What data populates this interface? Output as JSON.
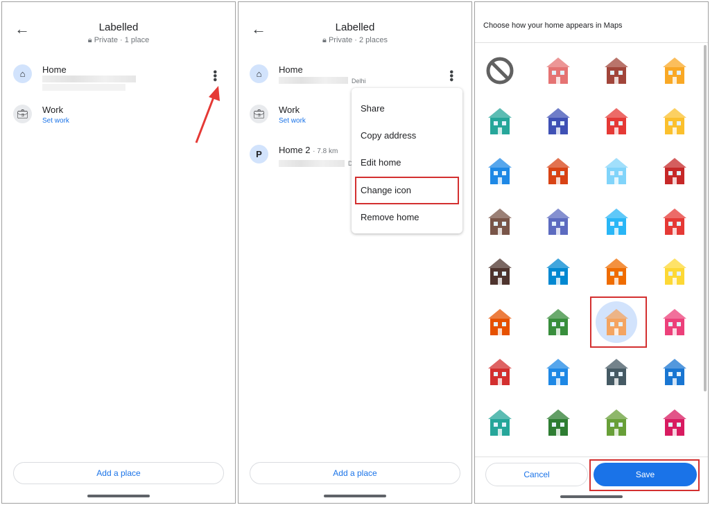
{
  "panel1": {
    "title": "Labelled",
    "subtitle": "Private · 1 place",
    "items": [
      {
        "name": "Home",
        "icon": "home-icon"
      },
      {
        "name": "Work",
        "link": "Set work",
        "icon": "briefcase-icon"
      }
    ],
    "add": "Add a place"
  },
  "panel2": {
    "title": "Labelled",
    "subtitle": "Private · 2 places",
    "items": [
      {
        "name": "Home",
        "meta": "Delhi"
      },
      {
        "name": "Work",
        "link": "Set work"
      },
      {
        "name": "Home 2",
        "distance": "· 7.8 km",
        "meta": "D"
      }
    ],
    "menu": [
      "Share",
      "Copy address",
      "Edit home",
      "Change icon",
      "Remove home"
    ],
    "add": "Add a place"
  },
  "panel3": {
    "heading": "Choose how your home appears in Maps",
    "cancel": "Cancel",
    "save": "Save",
    "selected_index": 22,
    "icons": [
      {
        "name": "none",
        "color": "#616161"
      },
      {
        "name": "brick-apartment",
        "color": "#e57373"
      },
      {
        "name": "barn",
        "color": "#a1453a"
      },
      {
        "name": "shop-building",
        "color": "#f9a825"
      },
      {
        "name": "camper-van",
        "color": "#26a69a"
      },
      {
        "name": "castle",
        "color": "#3f51b5"
      },
      {
        "name": "house-red-roof",
        "color": "#e53935"
      },
      {
        "name": "construction-crane",
        "color": "#fbc02d"
      },
      {
        "name": "skyscraper",
        "color": "#1e88e5"
      },
      {
        "name": "brick-house",
        "color": "#d84315"
      },
      {
        "name": "igloo",
        "color": "#81d4fa"
      },
      {
        "name": "lighthouse",
        "color": "#c62828"
      },
      {
        "name": "log-cabin",
        "color": "#795548"
      },
      {
        "name": "modern-building",
        "color": "#5c6bc0"
      },
      {
        "name": "store-front",
        "color": "#29b6f6"
      },
      {
        "name": "pagoda",
        "color": "#e53935"
      },
      {
        "name": "pirate-ship",
        "color": "#4e342e"
      },
      {
        "name": "sailboat",
        "color": "#0288d1"
      },
      {
        "name": "schoolhouse",
        "color": "#ef6c00"
      },
      {
        "name": "submarine",
        "color": "#fdd835"
      },
      {
        "name": "teepee",
        "color": "#e65100"
      },
      {
        "name": "treehouse",
        "color": "#388e3c"
      },
      {
        "name": "adobe-house",
        "color": "#f4a460"
      },
      {
        "name": "pink-shop",
        "color": "#ec407a"
      },
      {
        "name": "red-awning-store",
        "color": "#d32f2f"
      },
      {
        "name": "sofa",
        "color": "#1e88e5"
      },
      {
        "name": "tower",
        "color": "#455a64"
      },
      {
        "name": "dragon",
        "color": "#1976d2"
      },
      {
        "name": "green-store",
        "color": "#26a69a"
      },
      {
        "name": "green-victorian",
        "color": "#2e7d32"
      },
      {
        "name": "cottage",
        "color": "#689f38"
      },
      {
        "name": "pink-house",
        "color": "#d81b60"
      }
    ]
  },
  "colors": {
    "accent": "#1a73e8",
    "highlight": "#d32f2f",
    "arrow": "#e53935"
  }
}
